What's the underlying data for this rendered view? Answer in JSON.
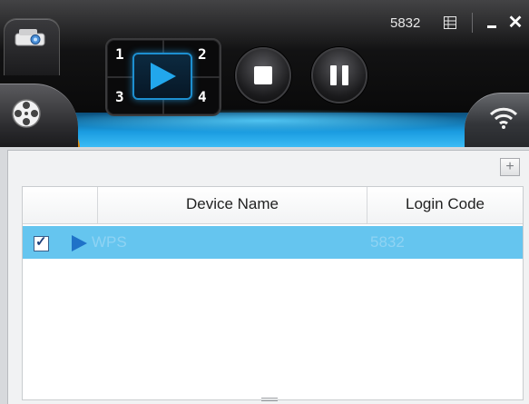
{
  "toolbar": {
    "login_code": "5832",
    "split_buttons": [
      "1",
      "2",
      "3",
      "4"
    ],
    "icons": {
      "projector": "projector-icon",
      "video": "film-reel-icon",
      "play": "play-icon",
      "stop": "stop-icon",
      "pause": "pause-icon",
      "grid": "grid-icon",
      "minimize": "minimize-icon",
      "close": "close-icon",
      "wifi": "wifi-icon"
    },
    "close_glyph": "✕"
  },
  "panel": {
    "add_glyph": "+",
    "table": {
      "headers": [
        "Device Name",
        "Login Code"
      ],
      "rows": [
        {
          "checked": true,
          "checkmark": "✓",
          "device_name": "WPS",
          "login_code": "5832"
        }
      ]
    }
  },
  "colors": {
    "accent_blue": "#1a9be0",
    "accent_orange": "#f2a020",
    "selected_row": "#65c5ef"
  }
}
